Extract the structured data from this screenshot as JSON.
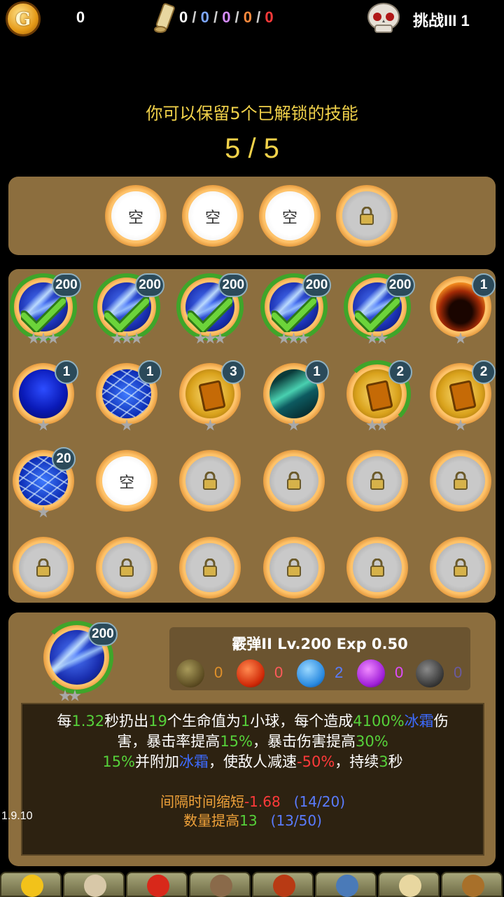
{
  "topbar": {
    "coin_glyph": "G",
    "gold": "0",
    "scroll_counts": {
      "white": "0",
      "blue": "0",
      "purple": "0",
      "orange": "0",
      "red": "0"
    },
    "challenge": "挑战III 1"
  },
  "keep": {
    "text": "你可以保留5个已解锁的技能",
    "count": "5 / 5"
  },
  "reserved_slots": [
    {
      "state": "empty",
      "label": "空"
    },
    {
      "state": "empty",
      "label": "空"
    },
    {
      "state": "empty",
      "label": "空"
    },
    {
      "state": "locked",
      "label": ""
    }
  ],
  "skills": [
    {
      "art": "ice",
      "badge": "200",
      "checked": true,
      "ring": "full",
      "stars": 3
    },
    {
      "art": "ice",
      "badge": "200",
      "checked": true,
      "ring": "full",
      "stars": 3
    },
    {
      "art": "ice",
      "badge": "200",
      "checked": true,
      "ring": "full",
      "stars": 3
    },
    {
      "art": "ice",
      "badge": "200",
      "checked": true,
      "ring": "full",
      "stars": 3
    },
    {
      "art": "ice",
      "badge": "200",
      "checked": true,
      "ring": "full",
      "stars": 2
    },
    {
      "art": "fire",
      "badge": "1",
      "checked": false,
      "ring": "none",
      "stars": 1
    },
    {
      "art": "bluepot",
      "badge": "1",
      "checked": false,
      "ring": "none",
      "stars": 1
    },
    {
      "art": "cracked",
      "badge": "1",
      "checked": false,
      "ring": "none",
      "stars": 1
    },
    {
      "art": "gold",
      "badge": "3",
      "checked": false,
      "ring": "none",
      "stars": 1
    },
    {
      "art": "wind",
      "badge": "1",
      "checked": false,
      "ring": "none",
      "stars": 1
    },
    {
      "art": "gold",
      "badge": "2",
      "checked": false,
      "ring": "partial",
      "stars": 2
    },
    {
      "art": "gold",
      "badge": "2",
      "checked": false,
      "ring": "none",
      "stars": 1
    },
    {
      "art": "cracked",
      "badge": "20",
      "checked": false,
      "ring": "none",
      "stars": 1
    },
    {
      "art": "empty",
      "label": "空"
    },
    {
      "art": "locked"
    },
    {
      "art": "locked"
    },
    {
      "art": "locked"
    },
    {
      "art": "locked"
    },
    {
      "art": "locked"
    },
    {
      "art": "locked"
    },
    {
      "art": "locked"
    },
    {
      "art": "locked"
    },
    {
      "art": "locked"
    },
    {
      "art": "locked"
    }
  ],
  "detail": {
    "badge": "200",
    "title": "霰弹II Lv.200  Exp 0.50",
    "elements": [
      {
        "name": "earth",
        "value": "0",
        "color": "#e0902a"
      },
      {
        "name": "fire",
        "value": "0",
        "color": "#ff5a5a"
      },
      {
        "name": "ice",
        "value": "2",
        "color": "#5a7cff"
      },
      {
        "name": "arcane",
        "value": "0",
        "color": "#e04aff"
      },
      {
        "name": "dark",
        "value": "0",
        "color": "#6a5aa0"
      }
    ],
    "desc": {
      "p1": "每",
      "v1": "1.32",
      "p2": "秒扔出",
      "v2": "19",
      "p3": "个生命值为",
      "v3": "1",
      "p4": "小球，每个造成",
      "v4": "4100%",
      "e1": "冰霜",
      "p5": "伤",
      "p6": "害，暴击率提高",
      "v5": "15%",
      "p7": "，暴击伤害提高",
      "v6": "30%",
      "v7": "15%",
      "p8": "并附加",
      "e2": "冰霜",
      "p9": "，使敌人减速",
      "v8": "-50%",
      "p10": "，持续",
      "v9": "3",
      "p11": "秒"
    },
    "upgrades": [
      {
        "label": "间隔时间缩短",
        "value": "-1.68",
        "progress": "(14/20)"
      },
      {
        "label": "数量提高",
        "value": "13",
        "progress": "(13/50)"
      }
    ]
  },
  "version": "1.9.10",
  "nav": [
    "hero",
    "pet",
    "gem",
    "forge",
    "book",
    "shop",
    "scroll",
    "settings"
  ]
}
